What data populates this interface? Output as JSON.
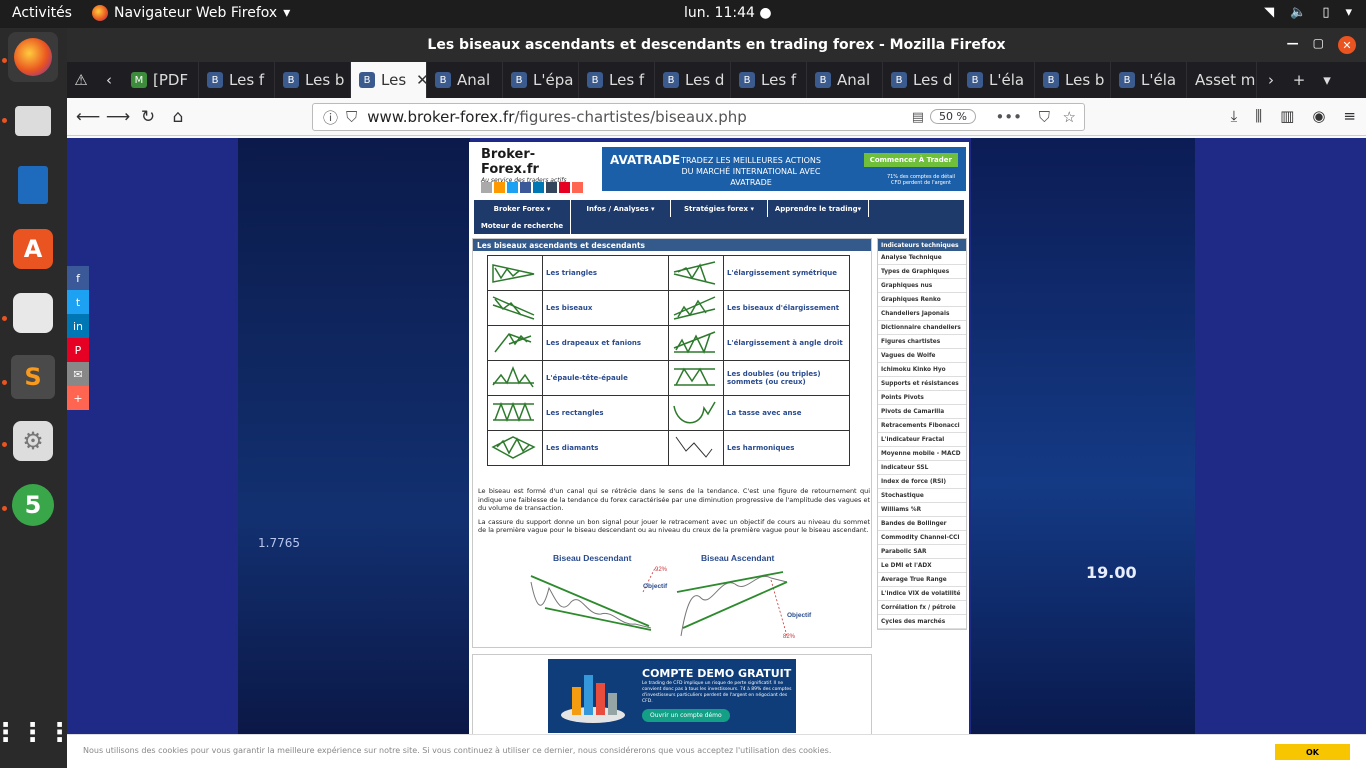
{
  "system": {
    "activities": "Activités",
    "app_name": "Navigateur Web Firefox",
    "clock": "lun. 11:44"
  },
  "window": {
    "title": "Les biseaux ascendants et descendants en trading forex - Mozilla Firefox"
  },
  "tabs": [
    {
      "label": "[PDF"
    },
    {
      "label": "Les f"
    },
    {
      "label": "Les b"
    },
    {
      "label": "Les"
    },
    {
      "label": "Anal"
    },
    {
      "label": "L'épa"
    },
    {
      "label": "Les f"
    },
    {
      "label": "Les d"
    },
    {
      "label": "Les f"
    },
    {
      "label": "Anal"
    },
    {
      "label": "Les d"
    },
    {
      "label": "L'éla"
    },
    {
      "label": "Les b"
    },
    {
      "label": "L'éla"
    },
    {
      "label": "Asset m"
    }
  ],
  "navbar": {
    "url_host": "www.broker-forex.fr",
    "url_path": "/figures-chartistes/biseaux.php",
    "zoom": "50 %"
  },
  "site": {
    "logo": "Broker-Forex.fr",
    "logo_sub": "Au service des traders actifs",
    "banner": {
      "brand": "AVATRADE",
      "line1": "TRADEZ LES MEILLEURES ACTIONS",
      "line2": "DU MARCHÉ INTERNATIONAL AVEC AVATRADE",
      "cta": "Commencer À Trader",
      "disclaimer": "71% des comptes de détail CFD perdent de l'argent"
    },
    "menu": [
      "Broker Forex",
      "Infos / Analyses",
      "Stratégies forex",
      "Apprendre le trading",
      "Moteur de recherche"
    ],
    "main_title": "Les biseaux ascendants et descendants",
    "figures": [
      [
        "Les triangles",
        "L'élargissement symétrique"
      ],
      [
        "Les biseaux",
        "Les biseaux d'élargissement"
      ],
      [
        "Les drapeaux et fanions",
        "L'élargissement à angle droit"
      ],
      [
        "L'épaule-tête-épaule",
        "Les doubles (ou triples) sommets (ou creux)"
      ],
      [
        "Les rectangles",
        "La tasse avec anse"
      ],
      [
        "Les diamants",
        "Les harmoniques"
      ]
    ],
    "para1": "Le biseau est formé d'un canal qui se rétrécie dans le sens de la tendance. C'est une figure de retournement qui indique une faiblesse de la tendance du forex caractérisée par une diminution progressive de l'amplitude des vagues et du volume de transaction.",
    "para2": "La cassure du support donne un bon signal pour jouer le retracement avec un objectif de cours au niveau du sommet de la première vague pour le biseau descendant ou au niveau du creux de la première vague pour le biseau ascendant.",
    "chart": {
      "left_title": "Biseau Descendant",
      "right_title": "Biseau Ascendant",
      "left_pct": "92%",
      "right_pct": "82%",
      "objectif": "Objectif"
    },
    "sidebar_title": "Indicateurs techniques",
    "sidebar": [
      "Analyse Technique",
      "Types de Graphiques",
      "Graphiques nus",
      "Graphiques Renko",
      "Chandeliers Japonais",
      "Dictionnaire chandeliers",
      "Figures chartistes",
      "Vagues de Wolfe",
      "Ichimoku Kinko Hyo",
      "Supports et résistances",
      "Points Pivots",
      "Pivots de Camarilla",
      "Retracements Fibonacci",
      "L'indicateur Fractal",
      "Moyenne mobile - MACD",
      "Indicateur SSL",
      "Index de force (RSI)",
      "Stochastique",
      "Williams %R",
      "Bandes de Bollinger",
      "Commodity Channel-CCI",
      "Parabolic SAR",
      "Le DMI et l'ADX",
      "Average True Range",
      "L'indice VIX de volatilité",
      "Corrélation fx / pétrole",
      "Cycles des marchés"
    ],
    "demo": {
      "title": "COMPTE DEMO GRATUIT",
      "desc": "Le trading de CFD implique un risque de perte significatif. Il ne convient donc pas à tous les investisseurs. 74 à 89% des comptes d'investisseurs particuliers perdent de l'argent en négociant des CFD.",
      "button": "Ouvrir un compte démo"
    },
    "bg_left_num": "1.7765",
    "bg_right_num": "19.00"
  },
  "cookie": {
    "text": "Nous utilisons des cookies pour vous garantir la meilleure expérience sur notre site. Si vous continuez à utiliser ce dernier, nous considérerons que vous acceptez l'utilisation des cookies.",
    "ok": "OK"
  },
  "colors": {
    "accent": "#e95420",
    "site_nav": "#1e3a6a",
    "site_header": "#345a8c",
    "ok_button": "#f7c600"
  }
}
